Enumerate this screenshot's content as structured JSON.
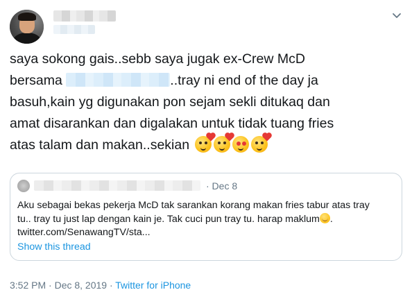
{
  "tweet": {
    "text_lines": [
      "saya sokong gais..sebb saya jugak ex-Crew McD",
      "bersama",
      "..tray ni end of the day ja",
      "basuh,kain yg digunakan pon sejam sekli ditukaq dan",
      "amat disarankan dan digalakan untuk tidak tuang fries",
      "atas talam dan makan..sekian"
    ],
    "emojis": [
      "kiss-wink-heart",
      "kiss-wink-heart",
      "heart-eyes",
      "smiling-face-with-hearts"
    ],
    "timestamp": "3:52 PM · Dec 8, 2019",
    "separator": " · ",
    "source": "Twitter for iPhone"
  },
  "quoted_tweet": {
    "date": "· Dec 8",
    "text_lines": [
      "Aku sebagai bekas pekerja McD tak sarankan korang makan fries tabur atas tray",
      "tu.. tray tu just lap dengan kain je. Tak cuci pun tray tu. harap maklum",
      "twitter.com/SenawangTV/sta..."
    ],
    "emoji": "smiling-face",
    "show_thread": "Show this thread"
  },
  "colors": {
    "text": "#14171a",
    "muted": "#657786",
    "link": "#1b95e0",
    "border": "#ccd6dd"
  }
}
